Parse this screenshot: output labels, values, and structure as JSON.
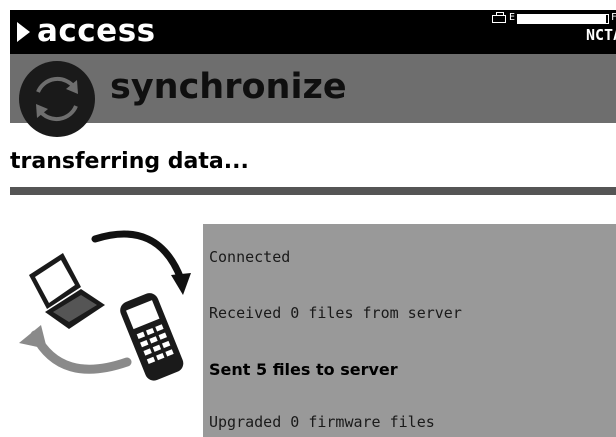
{
  "header": {
    "brand": "access",
    "battery_empty_label": "E",
    "battery_full_label": "F",
    "battery_level": 0.98,
    "connection": "NCTA"
  },
  "title_bar": {
    "title": "synchronize",
    "icon": "sync-icon"
  },
  "status": {
    "heading": "transferring data..."
  },
  "illustration": {
    "icons": [
      "laptop-icon",
      "handheld-device-icon",
      "cycle-arrows-icon"
    ]
  },
  "panel": {
    "lines": [
      {
        "text": "Connected",
        "emphasis": false
      },
      {
        "text": "Received 0 files from server",
        "emphasis": false
      },
      {
        "text": "Sent 5 files to server",
        "emphasis": true
      },
      {
        "text": "Upgraded 0 firmware files",
        "emphasis": false
      }
    ]
  },
  "colors": {
    "header_bg": "#000000",
    "title_bar_bg": "#6e6e6e",
    "panel_bg": "#999999",
    "divider": "#555555"
  }
}
